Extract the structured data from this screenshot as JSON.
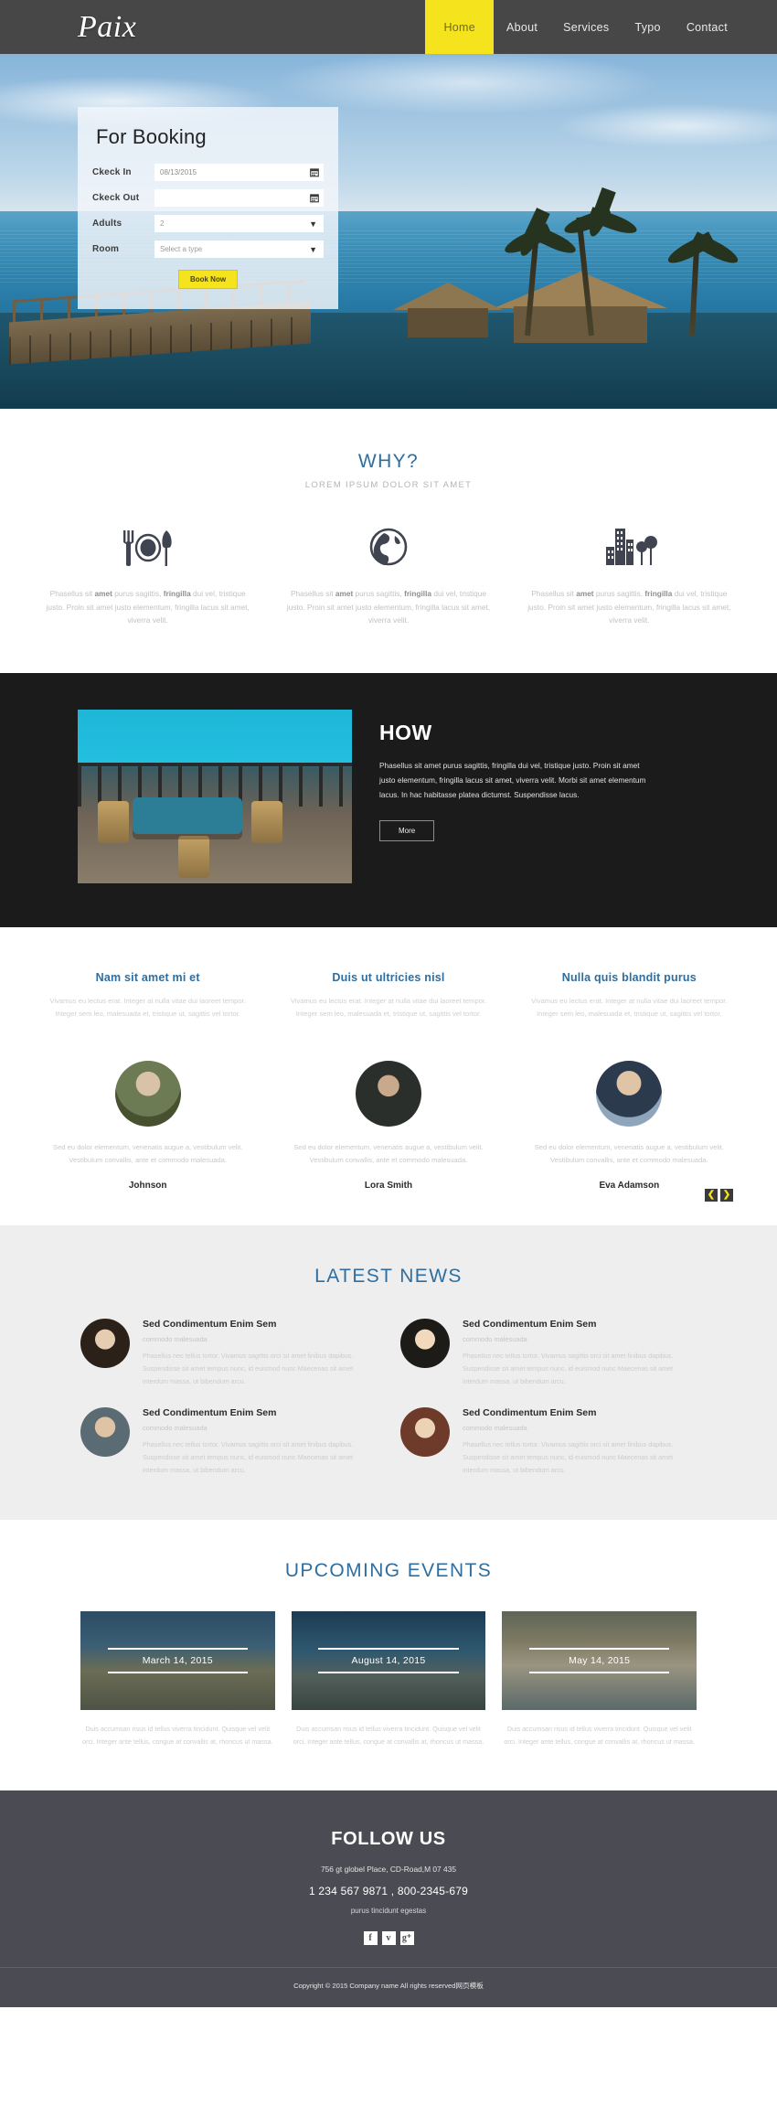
{
  "header": {
    "logo": "Paix",
    "nav": [
      {
        "label": "Home",
        "active": true
      },
      {
        "label": "About",
        "active": false
      },
      {
        "label": "Services",
        "active": false
      },
      {
        "label": "Typo",
        "active": false
      },
      {
        "label": "Contact",
        "active": false
      }
    ],
    "accent_color": "#f5e31d",
    "bar_color": "#474747"
  },
  "booking": {
    "title": "For Booking",
    "checkin_label": "Ckeck In",
    "checkin_value": "08/13/2015",
    "checkout_label": "Ckeck Out",
    "checkout_value": "",
    "checkout_placeholder": "",
    "adults_label": "Adults",
    "adults_value": "2",
    "room_label": "Room",
    "room_value": "Select a type",
    "submit_label": "Book Now"
  },
  "why": {
    "title": "WHY?",
    "subtitle": "LOREM IPSUM DOLOR SIT AMET",
    "items": [
      {
        "icon": "cutlery-plate-icon",
        "text_1": "Phasellus sit ",
        "bold_1": "amet",
        "text_2": " purus sagittis, ",
        "bold_2": "fringilla",
        "text_3": " dui vel, tristique justo. Proin sit amet justo elementum, fringilla lacus sit amet, viverra velit."
      },
      {
        "icon": "globe-icon",
        "text_1": "Phasellus sit ",
        "bold_1": "amet",
        "text_2": " purus sagittis, ",
        "bold_2": "fringilla",
        "text_3": " dui vel, tristique justo. Proin sit amet justo elementum, fringilla lacus sit amet, viverra velit."
      },
      {
        "icon": "city-buildings-icon",
        "text_1": "Phasellus sit ",
        "bold_1": "amet",
        "text_2": " purus sagittis, ",
        "bold_2": "fringilla",
        "text_3": " dui vel, tristique justo. Proin sit amet justo elementum, fringilla lacus sit amet, viverra velit."
      }
    ]
  },
  "how": {
    "title": "HOW",
    "body": "Phasellus sit amet purus sagittis, fringilla dui vel, tristique justo. Proin sit amet justo elementum, fringilla lacus sit amet, viverra velit. Morbi sit amet elementum lacus. In hac habitasse platea dictumst. Suspendisse lacus.",
    "button": "More"
  },
  "features": [
    {
      "title": "Nam sit amet mi et",
      "body": "Vivamus eu lectus erat. Integer at nulla vitae dui laoreet tempor. Integer sem leo, malesuada et, tristique ut, sagittis vel tortor."
    },
    {
      "title": "Duis ut ultricies nisl",
      "body": "Vivamus eu lectus erat. Integer at nulla vitae dui laoreet tempor. Integer sem leo, malesuada et, tristique ut, sagittis vel tortor."
    },
    {
      "title": "Nulla quis blandit purus",
      "body": "Vivamus eu lectus erat. Integer at nulla vitae dui laoreet tempor. Integer sem leo, malesuada et, tristique ut, sagittis vel tortor."
    }
  ],
  "testimonials": {
    "items": [
      {
        "name": "Johnson",
        "quote": "Sed eu dolor elementum, venenatis augue a, vestibulum velit. Vestibulum convallis, ante et commodo malesuada."
      },
      {
        "name": "Lora Smith",
        "quote": "Sed eu dolor elementum, venenatis augue a, vestibulum velit. Vestibulum convallis, ante et commodo malesuada."
      },
      {
        "name": "Eva Adamson",
        "quote": "Sed eu dolor elementum, venenatis augue a, vestibulum velit. Vestibulum convallis, ante et commodo malesuada."
      }
    ],
    "prev_label": "❮",
    "next_label": "❯"
  },
  "news": {
    "title": "LATEST NEWS",
    "items": [
      {
        "title": "Sed Condimentum Enim Sem",
        "meta": "commodo malesuada",
        "body": "Phasellus nec tellus tortor. Vivamus sagittis orci sit amet finibus dapibus. Suspendisse sit amet tempus nunc, id euismod nunc Maecenas sit amet interdum massa, ut bibendum arcu."
      },
      {
        "title": "Sed Condimentum Enim Sem",
        "meta": "commodo malesuada",
        "body": "Phasellus nec tellus tortor. Vivamus sagittis orci sit amet finibus dapibus. Suspendisse sit amet tempus nunc, id euismod nunc Maecenas sit amet interdum massa, ut bibendum arcu."
      },
      {
        "title": "Sed Condimentum Enim Sem",
        "meta": "commodo malesuada",
        "body": "Phasellus nec tellus tortor. Vivamus sagittis orci sit amet finibus dapibus. Suspendisse sit amet tempus nunc, id euismod nunc Maecenas sit amet interdum massa, ut bibendum arcu."
      },
      {
        "title": "Sed Condimentum Enim Sem",
        "meta": "commodo malesuada",
        "body": "Phasellus nec tellus tortor. Vivamus sagittis orci sit amet finibus dapibus. Suspendisse sit amet tempus nunc, id euismod nunc Maecenas sit amet interdum massa, ut bibendum arcu."
      }
    ]
  },
  "events": {
    "title": "UPCOMING EVENTS",
    "items": [
      {
        "date": "March 14, 2015",
        "body": "Duis accumsan risus id tellus viverra tincidunt. Quisque vel velit orci. Integer ante tellus, congue at convallis at, rhoncus ut massa."
      },
      {
        "date": "August 14, 2015",
        "body": "Duis accumsan risus id tellus viverra tincidunt. Quisque vel velit orci. Integer ante tellus, congue at convallis at, rhoncus ut massa."
      },
      {
        "date": "May 14, 2015",
        "body": "Duis accumsan risus id tellus viverra tincidunt. Quisque vel velit orci. Integer ante tellus, congue at convallis at, rhoncus ut massa."
      }
    ]
  },
  "footer": {
    "title": "FOLLOW US",
    "address": "756 gt globel Place, CD-Road,M 07 435",
    "phone": "1 234 567 9871 , 800-2345-679",
    "tagline": "purus tincidunt egestas",
    "socials": [
      {
        "name": "facebook-icon",
        "glyph": "f"
      },
      {
        "name": "twitter-icon",
        "glyph": "ᴠ"
      },
      {
        "name": "google-plus-icon",
        "glyph": "g⁺"
      }
    ],
    "copyright": "Copyright © 2015 Company name All rights reserved网页模板",
    "bar_color": "#4b4b53"
  }
}
